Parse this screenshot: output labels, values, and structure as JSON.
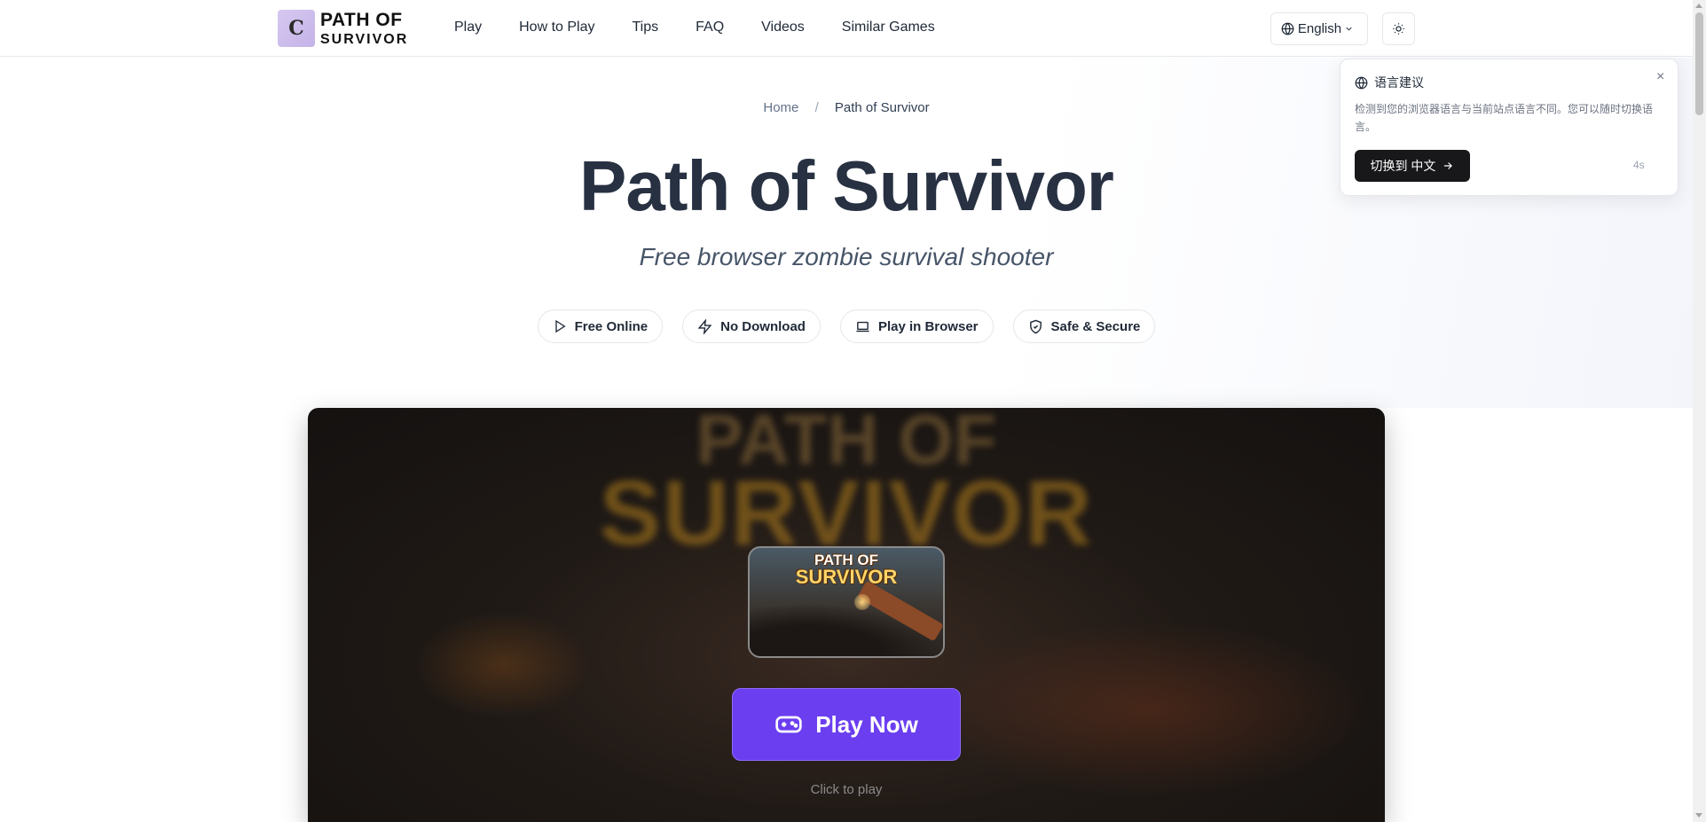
{
  "header": {
    "logo": {
      "mark": "C",
      "line1": "PATH OF",
      "line2": "SURVIVOR"
    },
    "nav": [
      {
        "label": "Play"
      },
      {
        "label": "How to Play"
      },
      {
        "label": "Tips"
      },
      {
        "label": "FAQ"
      },
      {
        "label": "Videos"
      },
      {
        "label": "Similar Games"
      }
    ],
    "language": "English",
    "icons": {
      "language": "globe-icon",
      "theme": "sun-icon",
      "dropdown": "chevron-down-icon"
    }
  },
  "breadcrumb": {
    "home": "Home",
    "separator": "/",
    "current": "Path of Survivor"
  },
  "hero": {
    "title": "Path of Survivor",
    "subtitle": "Free browser zombie survival shooter",
    "badges": [
      {
        "label": "Free Online",
        "icon": "play-icon"
      },
      {
        "label": "No Download",
        "icon": "lightning-icon"
      },
      {
        "label": "Play in Browser",
        "icon": "laptop-icon"
      },
      {
        "label": "Safe & Secure",
        "icon": "shield-check-icon"
      }
    ]
  },
  "game": {
    "background_title_line1": "PATH OF",
    "background_title_line2": "SURVIVOR",
    "thumbnail_title_line1": "PATH OF",
    "thumbnail_title_line2": "SURVIVOR",
    "play_button": "Play Now",
    "play_icon": "gamepad-icon",
    "hint": "Click to play",
    "accent_color": "#6b3ef0"
  },
  "toast": {
    "title": "语言建议",
    "message": "检测到您的浏览器语言与当前站点语言不同。您可以随时切换语言。",
    "button": "切换到 中文",
    "countdown": "4s",
    "close": "×"
  }
}
